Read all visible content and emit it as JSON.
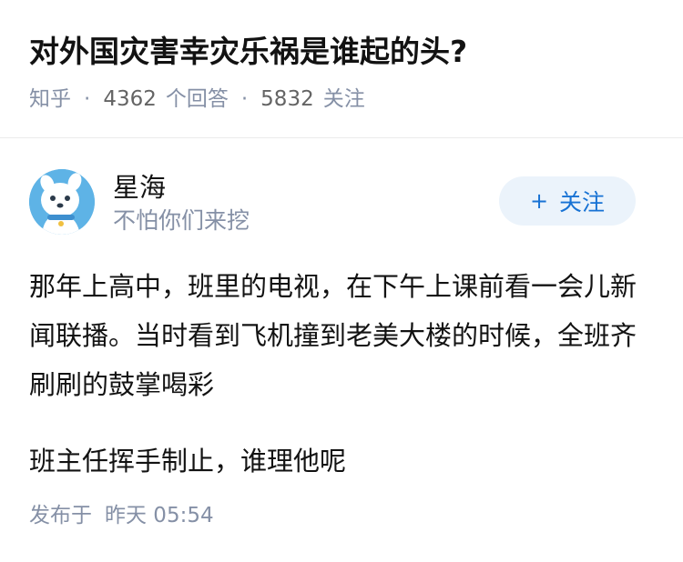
{
  "question": {
    "title": "对外国灾害幸灾乐祸是谁起的头?",
    "source": "知乎",
    "separator": "·",
    "answer_count": "4362",
    "answer_label": "个回答",
    "follower_count": "5832",
    "follower_label": "关注"
  },
  "author": {
    "avatar_icon": "cartoon-dog-avatar-icon",
    "name": "星海",
    "bio": "不怕你们来挖",
    "follow_plus": "+",
    "follow_label": "关注"
  },
  "answer": {
    "paragraphs": [
      "那年上高中，班里的电视，在下午上课前看一会儿新闻联播。当时看到飞机撞到老美大楼的时候，全班齐刷刷的鼓掌喝彩",
      "班主任挥手制止，谁理他呢"
    ],
    "published_label": "发布于",
    "published_time": "昨天 05:54"
  },
  "colors": {
    "title": "#121212",
    "meta": "#8590a6",
    "follow_bg": "#ebf3fb",
    "follow_text": "#1772d4",
    "avatar_bg": "#5eb3e6"
  }
}
